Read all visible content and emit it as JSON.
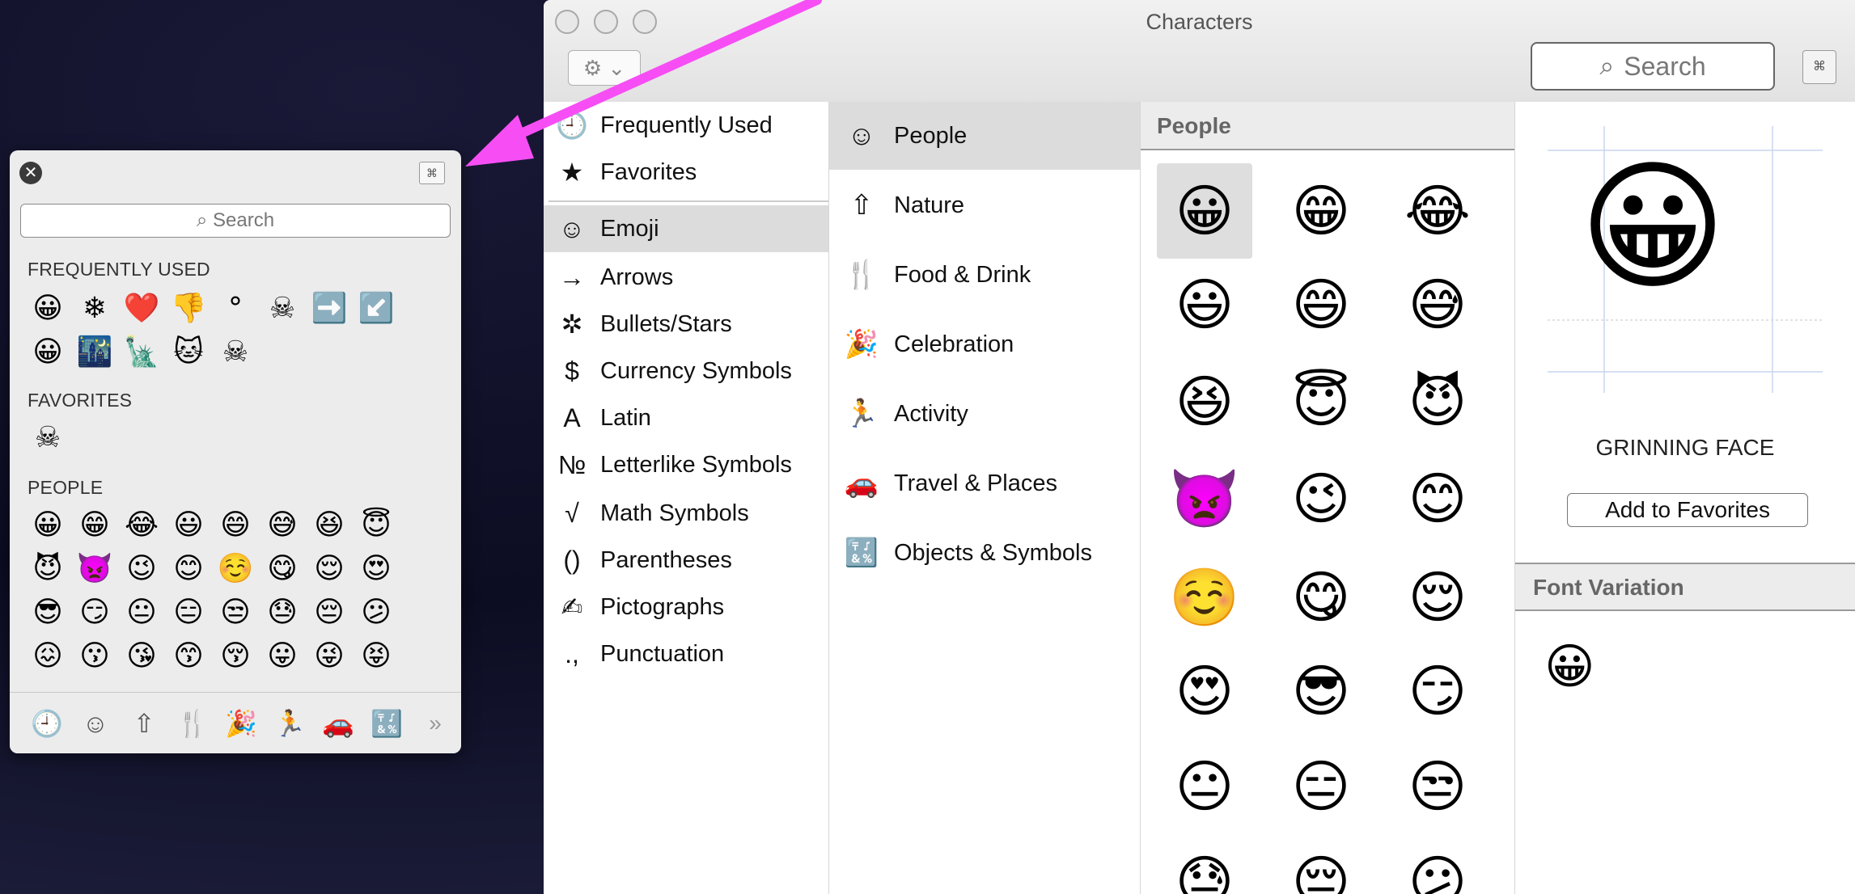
{
  "palette": {
    "close_glyph": "✕",
    "expand_glyph": "⌘",
    "search_placeholder": "Search",
    "sections": {
      "frequently_used": {
        "label": "FREQUENTLY USED",
        "row1": [
          "😀",
          "❄",
          "❤️",
          "👎",
          "°",
          "☠",
          "➡️",
          "↙️"
        ],
        "row2": [
          "😀",
          "🌃",
          "🗽",
          "🐱",
          "☠"
        ]
      },
      "favorites": {
        "label": "FAVORITES",
        "row1": [
          "☠"
        ]
      },
      "people": {
        "label": "PEOPLE",
        "row1": [
          "😀",
          "😁",
          "😂",
          "😃",
          "😄",
          "😅",
          "😆",
          "😇"
        ],
        "row2": [
          "😈",
          "👿",
          "😉",
          "😊",
          "☺️",
          "😋",
          "😌",
          "😍"
        ],
        "row3": [
          "😎",
          "😏",
          "😐",
          "😑",
          "😒",
          "😓",
          "😔",
          "😕"
        ],
        "row4": [
          "😖",
          "😗",
          "😘",
          "😙",
          "😚",
          "😛",
          "😜",
          "😝"
        ]
      }
    },
    "bottom_icons": [
      "🕘",
      "☺",
      "⇧",
      "🍴",
      "🎉",
      "🏃",
      "🚗",
      "🔣",
      "»"
    ]
  },
  "window": {
    "title": "Characters",
    "gear_glyph": "⚙ ⌄",
    "search_placeholder": "Search",
    "collapse_glyph": "⌘"
  },
  "categories": [
    {
      "icon": "🕘",
      "label": "Frequently Used"
    },
    {
      "icon": "★",
      "label": "Favorites"
    },
    {
      "icon": "☺",
      "label": "Emoji",
      "selected": true
    },
    {
      "icon": "→",
      "label": "Arrows"
    },
    {
      "icon": "✲",
      "label": "Bullets/Stars"
    },
    {
      "icon": "$",
      "label": "Currency Symbols"
    },
    {
      "icon": "A",
      "label": "Latin"
    },
    {
      "icon": "№",
      "label": "Letterlike Symbols"
    },
    {
      "icon": "√",
      "label": "Math Symbols"
    },
    {
      "icon": "()",
      "label": "Parentheses"
    },
    {
      "icon": "✍",
      "label": "Pictographs"
    },
    {
      "icon": ".,",
      "label": "Punctuation"
    }
  ],
  "emoji_groups": [
    {
      "icon": "☺",
      "label": "People",
      "selected": true
    },
    {
      "icon": "⇧",
      "label": "Nature"
    },
    {
      "icon": "🍴",
      "label": "Food & Drink"
    },
    {
      "icon": "🎉",
      "label": "Celebration"
    },
    {
      "icon": "🏃",
      "label": "Activity"
    },
    {
      "icon": "🚗",
      "label": "Travel & Places"
    },
    {
      "icon": "🔣",
      "label": "Objects & Symbols"
    }
  ],
  "grid": {
    "header": "People",
    "rows": [
      [
        "😀",
        "😁",
        "😂"
      ],
      [
        "😃",
        "😄",
        "😅"
      ],
      [
        "😆",
        "😇",
        "😈"
      ],
      [
        "👿",
        "😉",
        "😊"
      ],
      [
        "☺️",
        "😋",
        "😌"
      ],
      [
        "😍",
        "😎",
        "😏"
      ],
      [
        "😐",
        "😑",
        "😒"
      ],
      [
        "😓",
        "😔",
        "😕"
      ]
    ]
  },
  "detail": {
    "emoji": "😀",
    "name": "GRINNING FACE",
    "add_button": "Add to Favorites",
    "font_variation_header": "Font Variation",
    "font_variation_emoji": "😀"
  },
  "colors": {
    "arrow": "#f64ef4",
    "selection": "#dcdcdc",
    "active_tab": "#2a6fd6"
  }
}
